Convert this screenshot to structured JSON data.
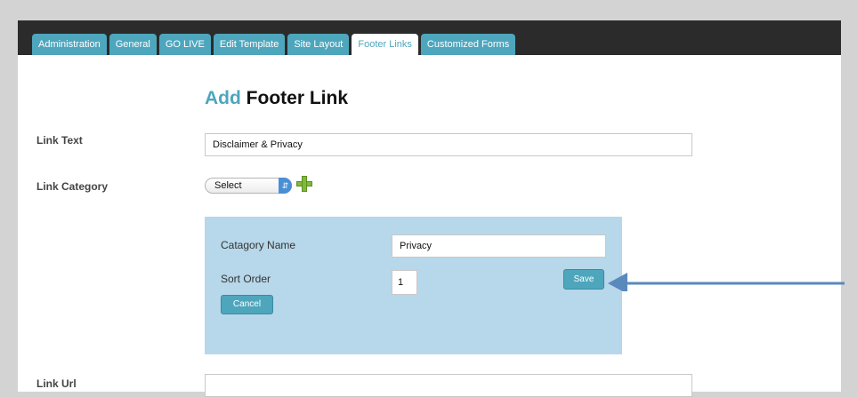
{
  "tabs": [
    {
      "label": "Administration"
    },
    {
      "label": "General"
    },
    {
      "label": "GO LIVE"
    },
    {
      "label": "Edit Template"
    },
    {
      "label": "Site Layout"
    },
    {
      "label": "Footer Links",
      "active": true
    },
    {
      "label": "Customized Forms"
    }
  ],
  "heading": {
    "accent": "Add",
    "rest": "Footer Link"
  },
  "form": {
    "link_text_label": "Link Text",
    "link_text_value": "Disclaimer & Privacy",
    "link_category_label": "Link Category",
    "link_category_value": "Select",
    "link_url_label": "Link Url",
    "link_url_value": ""
  },
  "category_panel": {
    "name_label": "Catagory Name",
    "name_value": "Privacy",
    "sort_label": "Sort Order",
    "sort_value": "1",
    "save_label": "Save",
    "cancel_label": "Cancel"
  },
  "colors": {
    "accent": "#4ea6bd",
    "topbar": "#2b2b2b",
    "subpanel": "#b7d7ea",
    "arrow": "#5a89bd"
  },
  "icons": {
    "add": "plus-icon",
    "dropdown": "chevron-updown-icon",
    "pointer": "arrow-icon"
  }
}
